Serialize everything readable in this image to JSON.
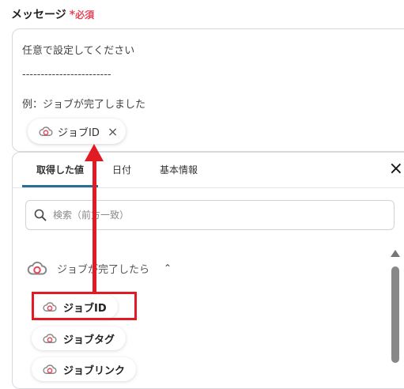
{
  "field": {
    "label": "メッセージ",
    "required_mark": "*",
    "required_text": "必須"
  },
  "message": {
    "line1": "任意で設定してください",
    "separator": "------------------------",
    "line3": "例：ジョブが完了しました",
    "chip_label": "ジョブID",
    "chip_close": "×"
  },
  "panel": {
    "tabs": [
      "取得した値",
      "日付",
      "基本情報"
    ],
    "close": "×",
    "search_placeholder": "検索（前方一致）",
    "group_label": "ジョブが完了したら",
    "group_caret": "⌃",
    "items": [
      "ジョブID",
      "ジョブタグ",
      "ジョブリンク"
    ]
  },
  "colors": {
    "required": "#e8455a",
    "accent": "#2b6e93",
    "annotation": "#e01b24"
  },
  "icons": {
    "app": "cloud-icon",
    "search": "search-icon",
    "close": "close-icon"
  }
}
